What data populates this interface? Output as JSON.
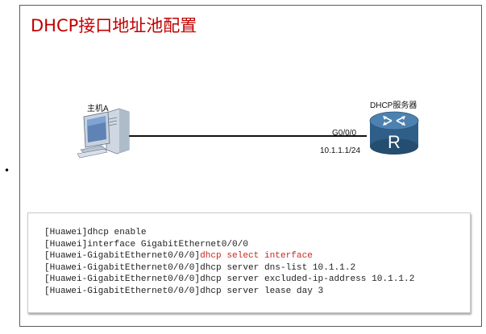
{
  "title": "DHCP接口地址池配置",
  "bullet": "•",
  "topology": {
    "host_label": "主机A",
    "server_label": "DHCP服务器",
    "interface_label": "G0/0/0",
    "ip_label": "10.1.1.1/24",
    "router_letter": "R"
  },
  "colors": {
    "title": "#c00000",
    "highlight": "#c8281e",
    "router_body": "#3b6e99",
    "link": "#111111"
  },
  "code": [
    {
      "prefix": "[Huawei]",
      "cmd": "dhcp enable",
      "highlight": false
    },
    {
      "prefix": "[Huawei]",
      "cmd": "interface GigabitEthernet0/0/0",
      "highlight": false
    },
    {
      "prefix": "[Huawei-GigabitEthernet0/0/0]",
      "cmd": "dhcp select interface",
      "highlight": true
    },
    {
      "prefix": "[Huawei-GigabitEthernet0/0/0]",
      "cmd": "dhcp server dns-list 10.1.1.2",
      "highlight": false
    },
    {
      "prefix": "[Huawei-GigabitEthernet0/0/0]",
      "cmd": "dhcp server excluded-ip-address 10.1.1.2",
      "highlight": false
    },
    {
      "prefix": "[Huawei-GigabitEthernet0/0/0]",
      "cmd": "dhcp server lease day 3",
      "highlight": false
    }
  ]
}
